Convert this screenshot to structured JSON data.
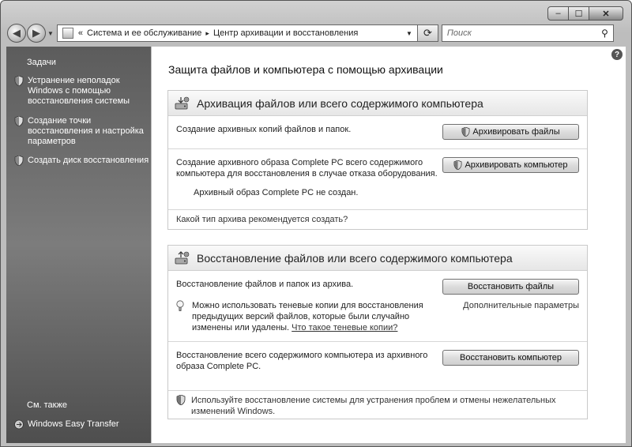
{
  "window": {
    "caption": {
      "minimize": "–",
      "maximize": "☐",
      "close": "✕"
    }
  },
  "nav": {
    "back_glyph": "◀",
    "forward_glyph": "▶",
    "address": {
      "prefix": "«",
      "crumbs": [
        "Система и ее обслуживание",
        "Центр архивации и восстановления"
      ],
      "separator": "▸"
    },
    "refresh_glyph": "⟳",
    "search_placeholder": "Поиск"
  },
  "sidebar": {
    "tasks_heading": "Задачи",
    "items": [
      {
        "label": "Устранение неполадок Windows с помощью восстановления системы"
      },
      {
        "label": "Создание точки восстановления и настройка параметров"
      },
      {
        "label": "Создать диск восстановления"
      }
    ],
    "see_also_heading": "См. также",
    "see_also_items": [
      {
        "label": "Windows Easy Transfer"
      }
    ]
  },
  "main": {
    "help_glyph": "?",
    "title": "Защита файлов и компьютера с помощью архивации",
    "backup": {
      "title": "Архивация файлов или всего содержимого компьютера",
      "row1_text": "Создание архивных копий файлов и папок.",
      "row1_button": "Архивировать файлы",
      "row2_text_line1": "Создание архивного образа Complete PC всего содержимого",
      "row2_text_line2": "компьютера для восстановления в случае отказа оборудования.",
      "row2_button": "Архивировать компьютер",
      "row2_status": "Архивный образ Complete PC не создан.",
      "row3_link": "Какой тип архива рекомендуется создать?"
    },
    "restore": {
      "title": "Восстановление файлов или всего содержимого компьютера",
      "row1_text": "Восстановление файлов и папок из архива.",
      "row1_button": "Восстановить файлы",
      "row1_advanced": "Дополнительные параметры",
      "tip_line1": "Можно использовать теневые копии для восстановления",
      "tip_line2": "предыдущих версий файлов, которые были случайно",
      "tip_line3": "изменены или удалены.",
      "tip_link": "Что такое теневые копии?",
      "row2_text_line1": "Восстановление всего содержимого компьютера из архивного",
      "row2_text_line2": "образа Complete PC.",
      "row2_button": "Восстановить компьютер",
      "row3_line1": "Используйте восстановление системы для устранения проблем и отмены нежелательных",
      "row3_line2": "изменений Windows."
    }
  },
  "colors": {
    "sidebar_top": "#5c5c5c",
    "sidebar_bottom": "#4e4e4e",
    "panel_border": "#c9c9c9"
  },
  "icons": {
    "task": "shield-icon",
    "section": "backup-drive-icon",
    "tip": "lightbulb-icon",
    "help": "help-icon"
  }
}
